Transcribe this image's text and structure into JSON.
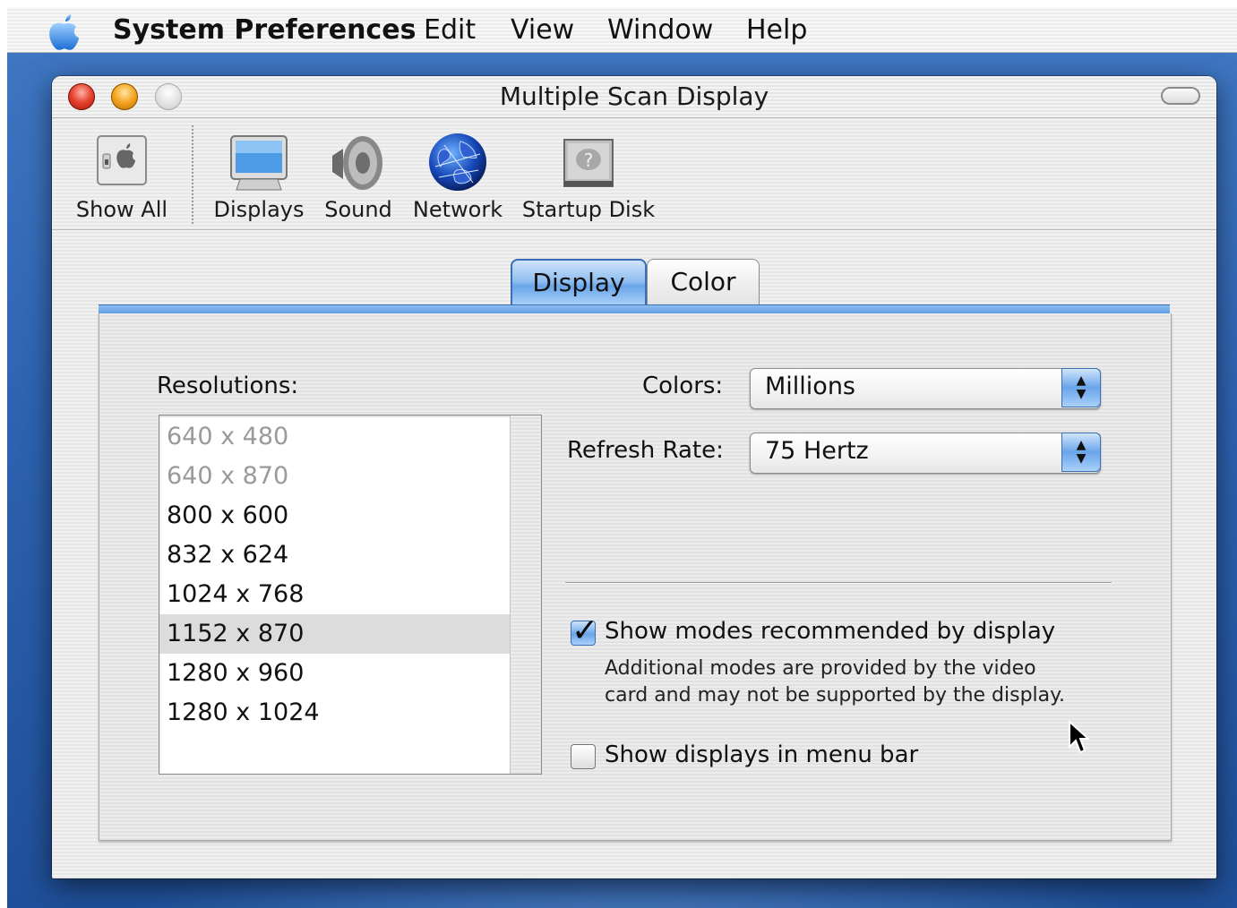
{
  "menubar": {
    "app_name": "System Preferences",
    "items": [
      "Edit",
      "View",
      "Window",
      "Help"
    ]
  },
  "window": {
    "title": "Multiple Scan Display"
  },
  "toolbar": {
    "items": [
      {
        "label": "Show All",
        "icon": "show-all-icon"
      },
      {
        "label": "Displays",
        "icon": "displays-icon"
      },
      {
        "label": "Sound",
        "icon": "speaker-icon"
      },
      {
        "label": "Network",
        "icon": "globe-icon"
      },
      {
        "label": "Startup Disk",
        "icon": "hard-disk-icon"
      }
    ]
  },
  "tabs": {
    "display": "Display",
    "color": "Color",
    "selected": "Display"
  },
  "resolutions": {
    "label": "Resolutions:",
    "items": [
      {
        "text": "640 x 480",
        "enabled": false
      },
      {
        "text": "640 x 870",
        "enabled": false
      },
      {
        "text": "800 x 600",
        "enabled": true
      },
      {
        "text": "832 x 624",
        "enabled": true
      },
      {
        "text": "1024 x 768",
        "enabled": true
      },
      {
        "text": "1152 x 870",
        "enabled": true,
        "selected": true
      },
      {
        "text": "1280 x 960",
        "enabled": true
      },
      {
        "text": "1280 x 1024",
        "enabled": true
      }
    ]
  },
  "colors": {
    "label": "Colors:",
    "value": "Millions"
  },
  "refresh_rate": {
    "label": "Refresh Rate:",
    "value": "75 Hertz"
  },
  "show_modes": {
    "label": "Show modes recommended by display",
    "checked": true,
    "note_line1": "Additional modes are provided by the video",
    "note_line2": "card and may not be supported by the display."
  },
  "show_menu_bar": {
    "label": "Show displays in menu bar",
    "checked": false
  },
  "colors_accent": {
    "aqua_blue": "#6aa5ea",
    "close_red": "#e5432e",
    "minimize_yellow": "#f5a623"
  }
}
